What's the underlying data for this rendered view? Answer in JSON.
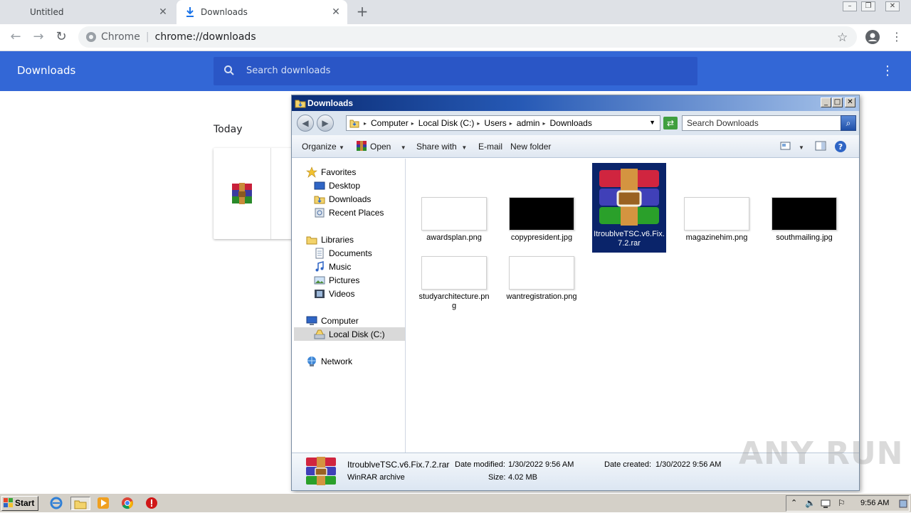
{
  "chrome": {
    "tabs": [
      {
        "label": "Untitled"
      },
      {
        "label": "Downloads"
      }
    ],
    "omnibox": {
      "site_label": "Chrome",
      "url": "chrome://downloads"
    },
    "downloads_page": {
      "title": "Downloads",
      "search_placeholder": "Search downloads",
      "section_label": "Today"
    }
  },
  "explorer": {
    "title": "Downloads",
    "breadcrumbs": [
      "Computer",
      "Local Disk (C:)",
      "Users",
      "admin",
      "Downloads"
    ],
    "search_placeholder": "Search Downloads",
    "commands": {
      "organize": "Organize",
      "open": "Open",
      "share_with": "Share with",
      "email": "E-mail",
      "new_folder": "New folder"
    },
    "nav": {
      "favorites": "Favorites",
      "desktop": "Desktop",
      "downloads": "Downloads",
      "recent_places": "Recent Places",
      "libraries": "Libraries",
      "documents": "Documents",
      "music": "Music",
      "pictures": "Pictures",
      "videos": "Videos",
      "computer": "Computer",
      "local_disk": "Local Disk (C:)",
      "network": "Network"
    },
    "files": [
      {
        "name": "awardsplan.png",
        "thumb": "light"
      },
      {
        "name": "copypresident.jpg",
        "thumb": "dark"
      },
      {
        "name": "ItroublveTSC.v6.Fix.7.2.rar",
        "thumb": "winrar"
      },
      {
        "name": "magazinehim.png",
        "thumb": "light"
      },
      {
        "name": "southmailing.jpg",
        "thumb": "dark"
      },
      {
        "name": "studyarchitecture.png",
        "thumb": "light"
      },
      {
        "name": "wantregistration.png",
        "thumb": "light"
      }
    ],
    "details": {
      "name": "ItroublveTSC.v6.Fix.7.2.rar",
      "type": "WinRAR archive",
      "date_modified_label": "Date modified:",
      "date_modified": "1/30/2022 9:56 AM",
      "size_label": "Size:",
      "size": "4.02 MB",
      "date_created_label": "Date created:",
      "date_created": "1/30/2022 9:56 AM"
    }
  },
  "taskbar": {
    "start_label": "Start",
    "clock": "9:56 AM"
  },
  "watermark": "ANY RUN",
  "colors": {
    "chrome_header": "#3367d6",
    "selection": "#0a246a"
  }
}
